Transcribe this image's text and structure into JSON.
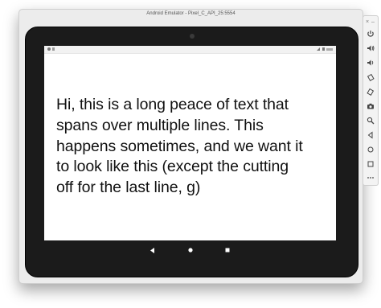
{
  "window": {
    "title": "Android Emulator - Pixel_C_API_25:5554"
  },
  "window_controls": {
    "close_label": "×",
    "minimize_label": "–"
  },
  "device_screen": {
    "text_lines": [
      "Hi, this is a long peace of text that",
      "spans over multiple lines. This",
      "happens sometimes, and we want it",
      "to look like this (except the cutting",
      "off for the last line, g)"
    ]
  },
  "toolbar": {
    "buttons": [
      {
        "icon": "power-icon"
      },
      {
        "icon": "volume-up-icon"
      },
      {
        "icon": "volume-down-icon"
      },
      {
        "icon": "rotate-left-icon"
      },
      {
        "icon": "rotate-right-icon"
      },
      {
        "icon": "camera-icon"
      },
      {
        "icon": "zoom-icon"
      },
      {
        "icon": "back-icon"
      },
      {
        "icon": "home-icon"
      },
      {
        "icon": "overview-icon"
      },
      {
        "icon": "more-icon"
      }
    ]
  },
  "colors": {
    "bezel": "#1b1b1b",
    "window_frame": "#ececec",
    "screen_background": "#ffffff",
    "text": "#111111"
  }
}
